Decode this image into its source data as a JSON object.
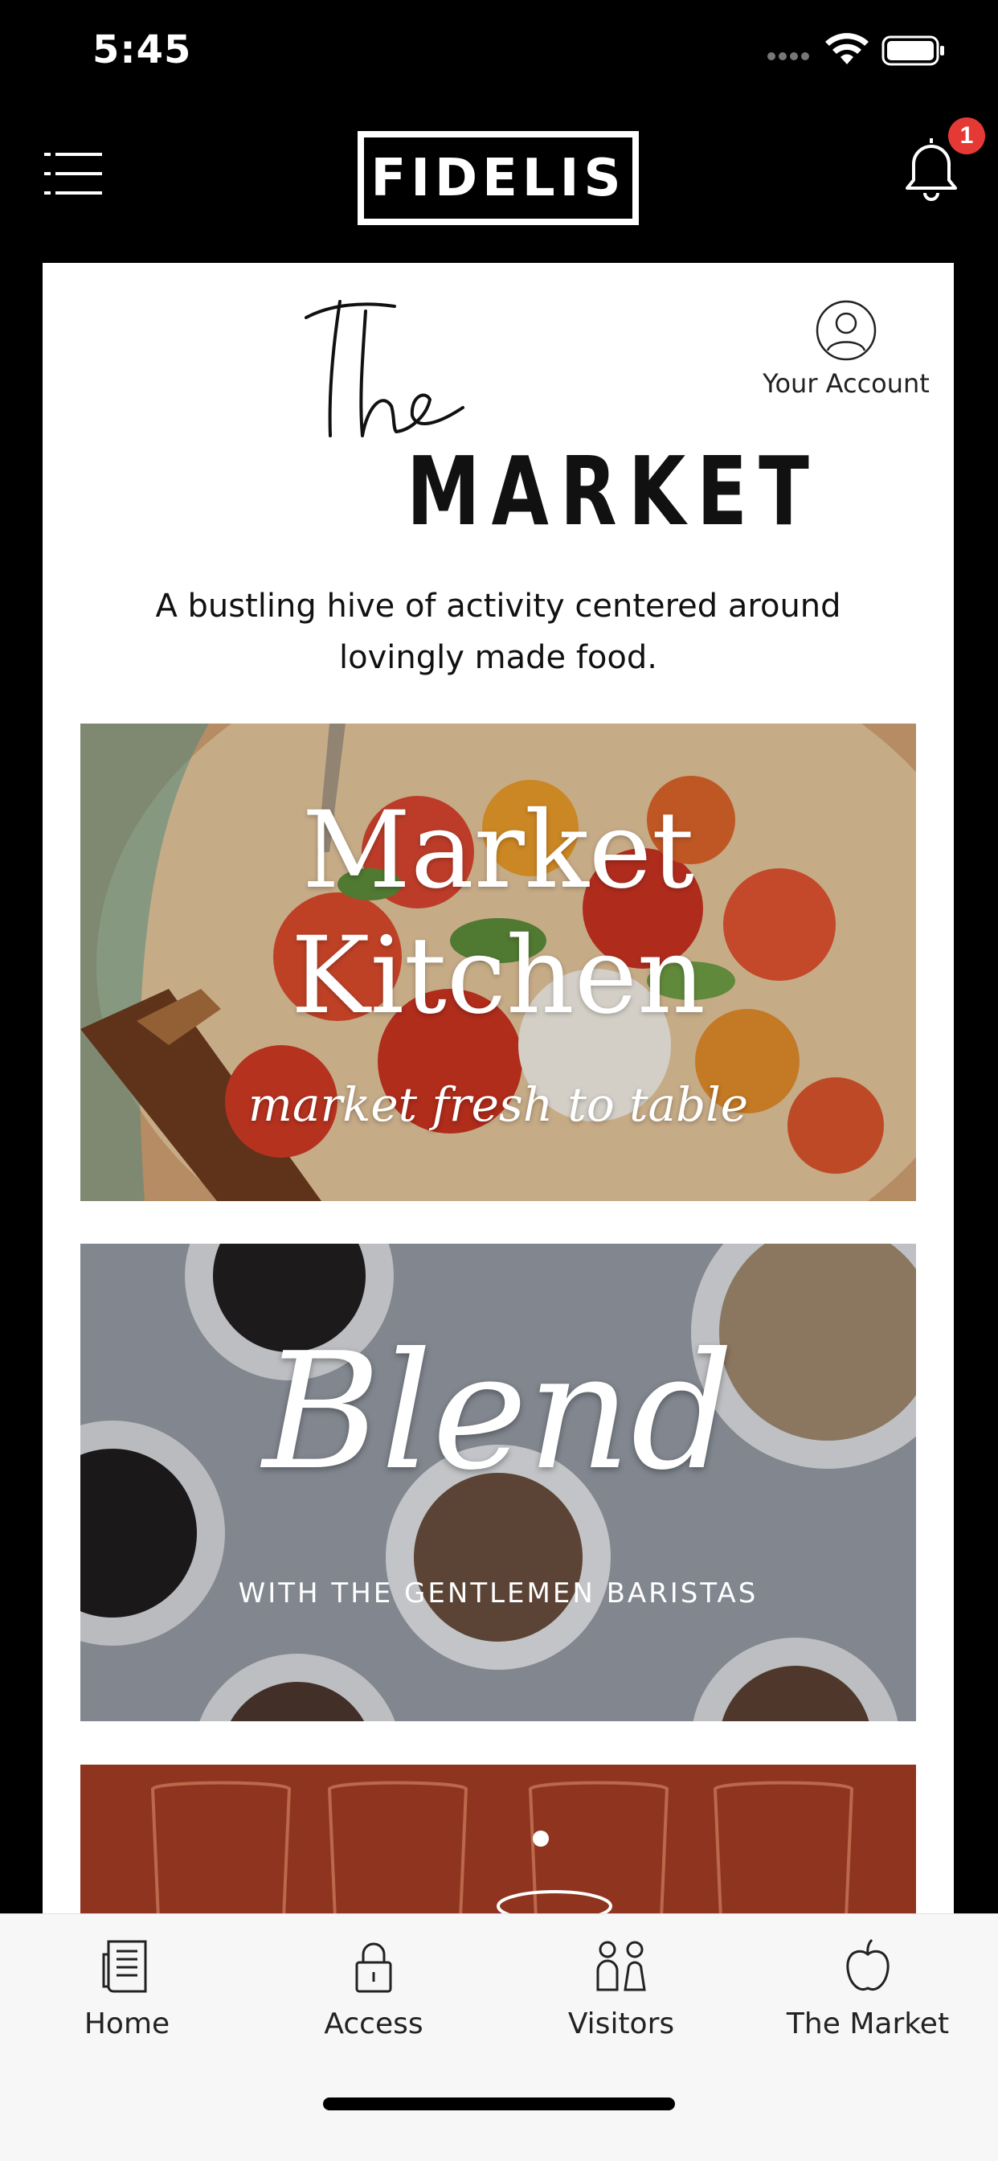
{
  "status_bar": {
    "time": "5:45",
    "icons": [
      "signal-dots-icon",
      "wifi-icon",
      "battery-icon"
    ]
  },
  "header": {
    "logo": "FIDELIS",
    "menu_icon": "hamburger-menu-icon",
    "notifications_icon": "bell-icon",
    "notification_count": "1"
  },
  "page": {
    "logo_script": "the",
    "logo_word": "MARKET",
    "account_label": "Your Account",
    "tagline": "A bustling hive of activity centered around lovingly made food."
  },
  "banners": [
    {
      "title_line1": "Market",
      "title_line2": "Kitchen",
      "subtitle": "market fresh to table"
    },
    {
      "title": "Blend",
      "subtitle": "WITH THE GENTLEMEN BARISTAS"
    },
    {
      "title": ""
    }
  ],
  "tabs": [
    {
      "label": "Home",
      "icon": "document-icon"
    },
    {
      "label": "Access",
      "icon": "lock-icon"
    },
    {
      "label": "Visitors",
      "icon": "people-icon"
    },
    {
      "label": "The Market",
      "icon": "apple-icon"
    }
  ],
  "colors": {
    "header_bg": "#000000",
    "badge": "#e53935",
    "content_bg": "#ffffff",
    "tab_bar_bg": "#f7f7f7"
  }
}
